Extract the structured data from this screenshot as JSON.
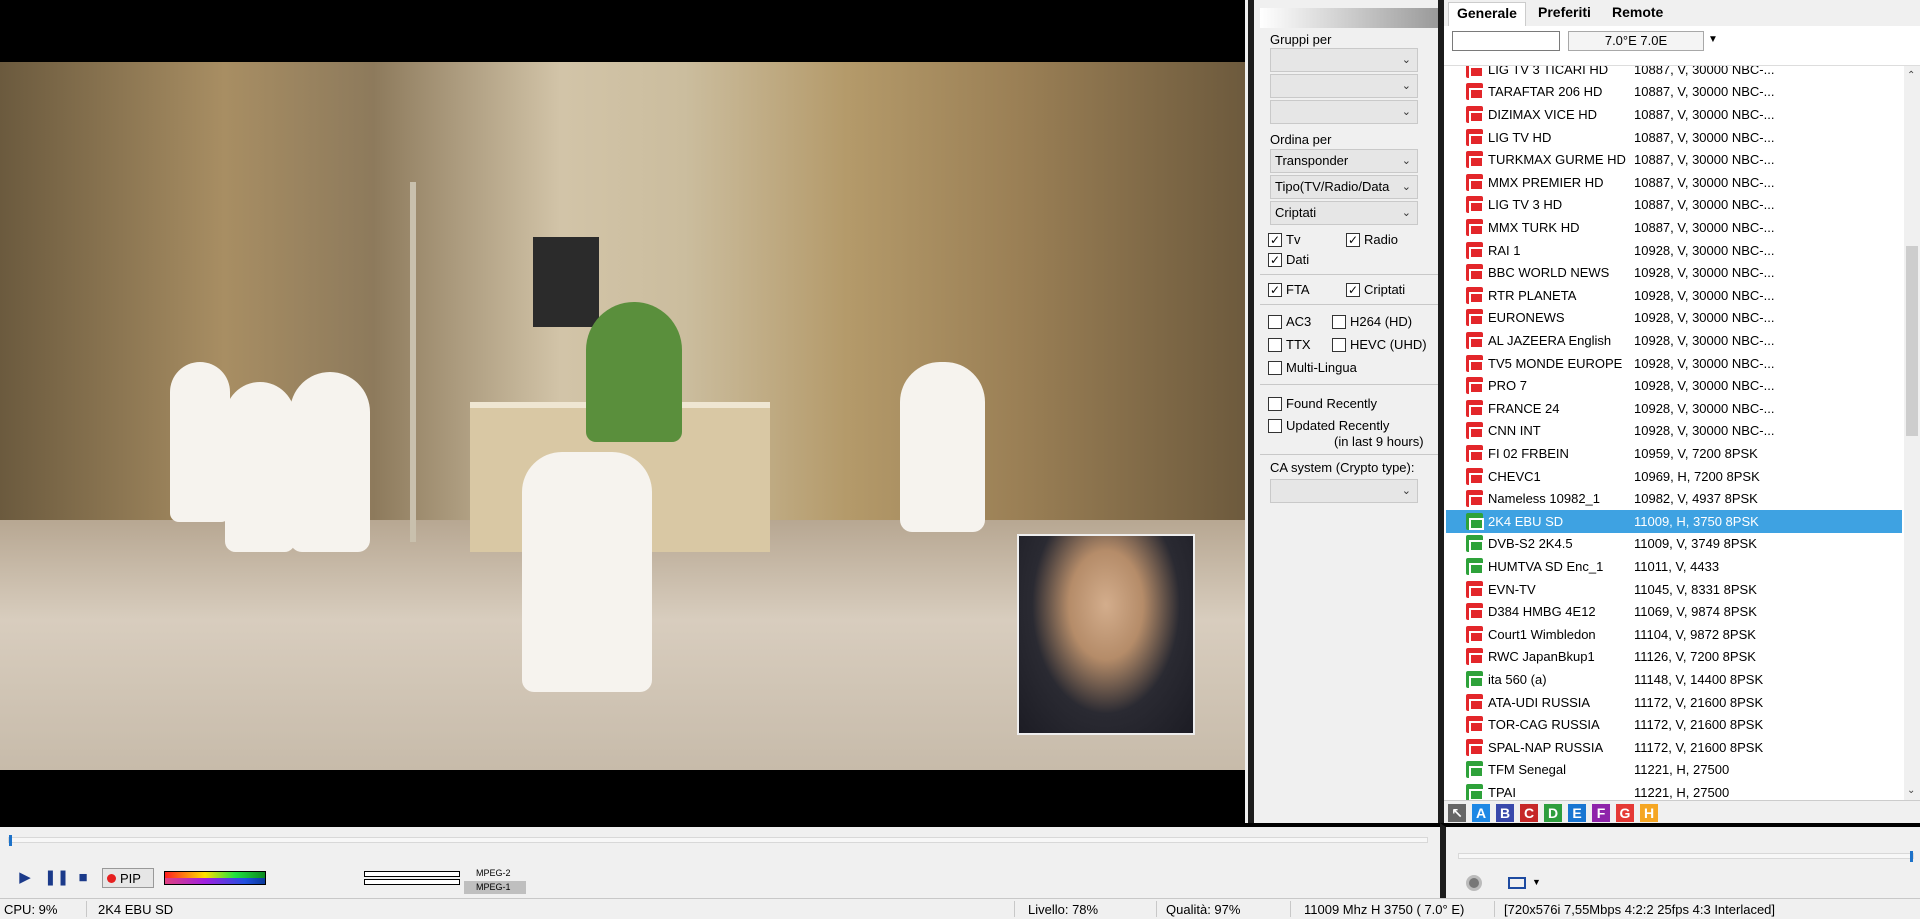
{
  "filters": {
    "group_label": "Gruppi per",
    "group_selects": [
      "",
      "",
      ""
    ],
    "sort_label": "Ordina per",
    "sort_selects": [
      "Transponder",
      "Tipo(TV/Radio/Data",
      "Criptati"
    ],
    "tv": "Tv",
    "radio": "Radio",
    "dati": "Dati",
    "fta": "FTA",
    "criptati": "Criptati",
    "ac3": "AC3",
    "h264": "H264 (HD)",
    "ttx": "TTX",
    "hevc": "HEVC (UHD)",
    "multilingua": "Multi-Lingua",
    "found_recently": "Found Recently",
    "updated_recently": "Updated Recently",
    "in_last": "(in last 9 hours)",
    "ca_label": "CA system (Crypto type):",
    "ca_select": ""
  },
  "tabs": [
    "Generale",
    "Preferiti",
    "Remote"
  ],
  "search": {
    "value": "",
    "satellite": "7.0°E 7.0E"
  },
  "channels": [
    {
      "name": "LIG TV 3 TICARI HD",
      "info": "10887, V, 30000 NBC-...",
      "type": "red"
    },
    {
      "name": "TARAFTAR 206 HD",
      "info": "10887, V, 30000 NBC-...",
      "type": "red"
    },
    {
      "name": "DIZIMAX VICE HD",
      "info": "10887, V, 30000 NBC-...",
      "type": "red"
    },
    {
      "name": "LIG TV HD",
      "info": "10887, V, 30000 NBC-...",
      "type": "red"
    },
    {
      "name": "TURKMAX GURME HD",
      "info": "10887, V, 30000 NBC-...",
      "type": "red"
    },
    {
      "name": "MMX PREMIER HD",
      "info": "10887, V, 30000 NBC-...",
      "type": "red"
    },
    {
      "name": "LIG TV 3 HD",
      "info": "10887, V, 30000 NBC-...",
      "type": "red"
    },
    {
      "name": "MMX TURK HD",
      "info": "10887, V, 30000 NBC-...",
      "type": "red"
    },
    {
      "name": "RAI 1",
      "info": "10928, V, 30000 NBC-...",
      "type": "red"
    },
    {
      "name": "BBC WORLD NEWS",
      "info": "10928, V, 30000 NBC-...",
      "type": "red"
    },
    {
      "name": "RTR PLANETA",
      "info": "10928, V, 30000 NBC-...",
      "type": "red"
    },
    {
      "name": "EURONEWS",
      "info": "10928, V, 30000 NBC-...",
      "type": "red"
    },
    {
      "name": "AL JAZEERA English",
      "info": "10928, V, 30000 NBC-...",
      "type": "red"
    },
    {
      "name": "TV5 MONDE EUROPE",
      "info": "10928, V, 30000 NBC-...",
      "type": "red"
    },
    {
      "name": "PRO 7",
      "info": "10928, V, 30000 NBC-...",
      "type": "red"
    },
    {
      "name": "FRANCE 24",
      "info": "10928, V, 30000 NBC-...",
      "type": "red"
    },
    {
      "name": "CNN INT",
      "info": "10928, V, 30000 NBC-...",
      "type": "red"
    },
    {
      "name": "FI 02 FRBEIN",
      "info": "10959, V, 7200 8PSK",
      "type": "red"
    },
    {
      "name": "CHEVC1",
      "info": "10969, H, 7200 8PSK",
      "type": "red"
    },
    {
      "name": "Nameless 10982_1",
      "info": "10982, V, 4937 8PSK",
      "type": "red"
    },
    {
      "name": "2K4 EBU SD",
      "info": "11009, H, 3750 8PSK",
      "type": "green",
      "selected": true
    },
    {
      "name": "DVB-S2 2K4.5",
      "info": "11009, V, 3749 8PSK",
      "type": "green"
    },
    {
      "name": "HUMTVA SD Enc_1",
      "info": "11011, V, 4433",
      "type": "green"
    },
    {
      "name": "EVN-TV",
      "info": "11045, V, 8331 8PSK",
      "type": "red"
    },
    {
      "name": "D384 HMBG 4E12",
      "info": "11069, V, 9874 8PSK",
      "type": "red"
    },
    {
      "name": "Court1 Wimbledon",
      "info": "11104, V, 9872 8PSK",
      "type": "red"
    },
    {
      "name": "RWC JapanBkup1",
      "info": "11126, V, 7200 8PSK",
      "type": "red"
    },
    {
      "name": "ita 560 (a)",
      "info": "11148, V, 14400 8PSK",
      "type": "green"
    },
    {
      "name": "ATA-UDI RUSSIA",
      "info": "11172, V, 21600 8PSK",
      "type": "red"
    },
    {
      "name": "TOR-CAG RUSSIA",
      "info": "11172, V, 21600 8PSK",
      "type": "red"
    },
    {
      "name": "SPAL-NAP RUSSIA",
      "info": "11172, V, 21600 8PSK",
      "type": "red"
    },
    {
      "name": "TFM Senegal",
      "info": "11221, H, 27500",
      "type": "green"
    },
    {
      "name": "TPAI",
      "info": "11221, H, 27500",
      "type": "green"
    }
  ],
  "letters": [
    {
      "l": "A",
      "color": "#1e88e5"
    },
    {
      "l": "B",
      "color": "#3949ab"
    },
    {
      "l": "C",
      "color": "#c62828"
    },
    {
      "l": "D",
      "color": "#2e9e3e"
    },
    {
      "l": "E",
      "color": "#1976d2"
    },
    {
      "l": "F",
      "color": "#8e24aa"
    },
    {
      "l": "G",
      "color": "#e53935"
    },
    {
      "l": "H",
      "color": "#f5a623"
    }
  ],
  "controls": {
    "pip": "PIP",
    "codec_video": "MPEG-2",
    "codec_audio": "MPEG-1"
  },
  "status": {
    "cpu": "CPU: 9%",
    "channel": "2K4 EBU SD",
    "livello": "Livello: 78%",
    "qualita": "Qualità: 97%",
    "tuning": "11009 Mhz  H  3750  ( 7.0° E)",
    "video": "[720x576i  7,55Mbps 4:2:2 25fps 4:3 Interlaced]"
  },
  "colors": {
    "selected": "#3ea2e2",
    "tv_red": "#e3262a",
    "tv_green": "#2ea23a"
  }
}
